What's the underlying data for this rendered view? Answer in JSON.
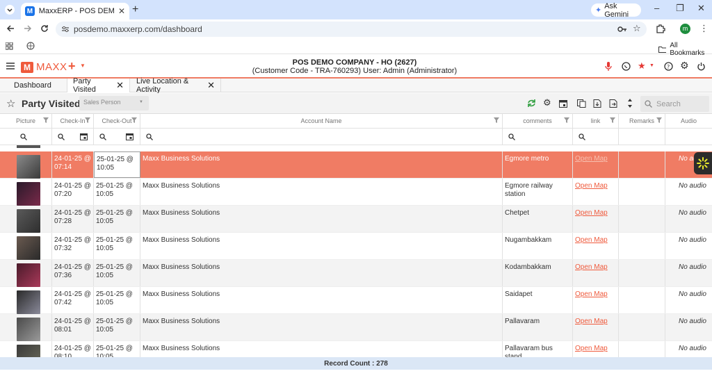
{
  "browser": {
    "tab_title": "MaxxERP - POS DEMO COMPAN",
    "tab_favicon": "M",
    "gemini_label": "Ask Gemini",
    "url": "posdemo.maxxerp.com/dashboard",
    "profile_initial": "m",
    "bookmarks_label": "All Bookmarks"
  },
  "app": {
    "logo_mark": "M",
    "logo_text": "MAXX",
    "company_line1": "POS DEMO COMPANY - HO (2627)",
    "company_line2": "(Customer Code - TRA-760293) User: Admin (Administrator)",
    "accent_color": "#ef5a3c"
  },
  "module_tabs": [
    {
      "label": "Dashboard"
    },
    {
      "label": "Party Visited"
    },
    {
      "label": "Live Location & Activity"
    }
  ],
  "toolbar": {
    "title": "Party Visited",
    "sales_person_placeholder": "Sales Person",
    "search_placeholder": "Search"
  },
  "columns": [
    "Picture",
    "Check-In",
    "Check-Out",
    "Account Name",
    "comments",
    "link",
    "Remarks",
    "Audio"
  ],
  "rows": [
    {
      "check_in": "24-01-25 @ 07:14",
      "check_out": "25-01-25 @ 10:05",
      "account": "Maxx Business Solutions",
      "comments": "Egmore metro",
      "link": "Open Map",
      "remarks": "",
      "audio": "No audio",
      "selected": true
    },
    {
      "check_in": "24-01-25 @ 07:20",
      "check_out": "25-01-25 @ 10:05",
      "account": "Maxx Business Solutions",
      "comments": "Egmore railway station",
      "link": "Open Map",
      "remarks": "",
      "audio": "No audio"
    },
    {
      "check_in": "24-01-25 @ 07:28",
      "check_out": "25-01-25 @ 10:05",
      "account": "Maxx Business Solutions",
      "comments": "Chetpet",
      "link": "Open Map",
      "remarks": "",
      "audio": "No audio"
    },
    {
      "check_in": "24-01-25 @ 07:32",
      "check_out": "25-01-25 @ 10:05",
      "account": "Maxx Business Solutions",
      "comments": "Nugambakkam",
      "link": "Open Map",
      "remarks": "",
      "audio": "No audio"
    },
    {
      "check_in": "24-01-25 @ 07:36",
      "check_out": "25-01-25 @ 10:05",
      "account": "Maxx Business Solutions",
      "comments": "Kodambakkam",
      "link": "Open Map",
      "remarks": "",
      "audio": "No audio"
    },
    {
      "check_in": "24-01-25 @ 07:42",
      "check_out": "25-01-25 @ 10:05",
      "account": "Maxx Business Solutions",
      "comments": "Saidapet",
      "link": "Open Map",
      "remarks": "",
      "audio": "No audio"
    },
    {
      "check_in": "24-01-25 @ 08:01",
      "check_out": "25-01-25 @ 10:05",
      "account": "Maxx Business Solutions",
      "comments": "Pallavaram",
      "link": "Open Map",
      "remarks": "",
      "audio": "No audio"
    },
    {
      "check_in": "24-01-25 @ 08:10",
      "check_out": "25-01-25 @ 10:05",
      "account": "Maxx Business Solutions",
      "comments": "Pallavaram bus stand",
      "link": "Open Map",
      "remarks": "",
      "audio": "No audio"
    }
  ],
  "footer": {
    "record_count": "Record Count : 278"
  }
}
